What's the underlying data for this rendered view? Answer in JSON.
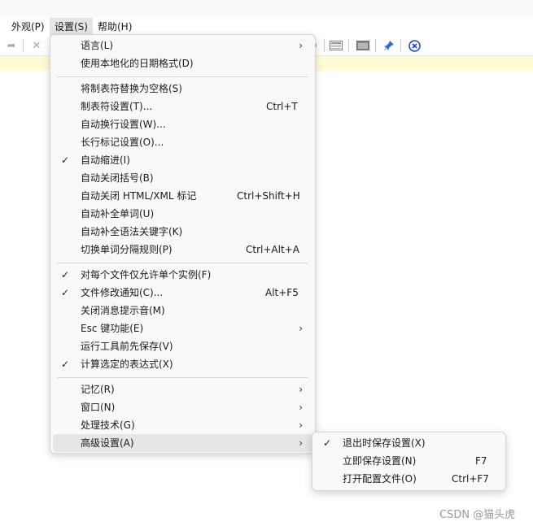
{
  "menubar": [
    "外观(P)",
    "设置(S)",
    "帮助(H)"
  ],
  "settings_menu": {
    "items": [
      {
        "label": "语言(L)",
        "check": false,
        "shortcut": "",
        "submenu": true
      },
      {
        "label": "使用本地化的日期格式(D)",
        "check": false,
        "shortcut": "",
        "submenu": false
      },
      {
        "label": "将制表符替换为空格(S)",
        "check": false,
        "shortcut": "",
        "submenu": false
      },
      {
        "label": "制表符设置(T)...",
        "check": false,
        "shortcut": "Ctrl+T",
        "submenu": false
      },
      {
        "label": "自动换行设置(W)...",
        "check": false,
        "shortcut": "",
        "submenu": false
      },
      {
        "label": "长行标记设置(O)...",
        "check": false,
        "shortcut": "",
        "submenu": false
      },
      {
        "label": "自动缩进(I)",
        "check": true,
        "shortcut": "",
        "submenu": false
      },
      {
        "label": "自动关闭括号(B)",
        "check": false,
        "shortcut": "",
        "submenu": false
      },
      {
        "label": "自动关闭 HTML/XML 标记",
        "check": false,
        "shortcut": "Ctrl+Shift+H",
        "submenu": false
      },
      {
        "label": "自动补全单词(U)",
        "check": false,
        "shortcut": "",
        "submenu": false
      },
      {
        "label": "自动补全语法关键字(K)",
        "check": false,
        "shortcut": "",
        "submenu": false
      },
      {
        "label": "切换单词分隔规则(P)",
        "check": false,
        "shortcut": "Ctrl+Alt+A",
        "submenu": false
      },
      {
        "label": "对每个文件仅允许单个实例(F)",
        "check": true,
        "shortcut": "",
        "submenu": false
      },
      {
        "label": "文件修改通知(C)...",
        "check": true,
        "shortcut": "Alt+F5",
        "submenu": false
      },
      {
        "label": "关闭消息提示音(M)",
        "check": false,
        "shortcut": "",
        "submenu": false
      },
      {
        "label": "Esc 键功能(E)",
        "check": false,
        "shortcut": "",
        "submenu": true
      },
      {
        "label": "运行工具前先保存(V)",
        "check": false,
        "shortcut": "",
        "submenu": false
      },
      {
        "label": "计算选定的表达式(X)",
        "check": true,
        "shortcut": "",
        "submenu": false
      },
      {
        "label": "记忆(R)",
        "check": false,
        "shortcut": "",
        "submenu": true
      },
      {
        "label": "窗口(N)",
        "check": false,
        "shortcut": "",
        "submenu": true
      },
      {
        "label": "处理技术(G)",
        "check": false,
        "shortcut": "",
        "submenu": true
      },
      {
        "label": "高级设置(A)",
        "check": false,
        "shortcut": "",
        "submenu": true,
        "highlighted": true
      }
    ]
  },
  "advanced_submenu": {
    "items": [
      {
        "label": "退出时保存设置(X)",
        "check": true,
        "shortcut": ""
      },
      {
        "label": "立即保存设置(N)",
        "check": false,
        "shortcut": "F7"
      },
      {
        "label": "打开配置文件(O)",
        "check": false,
        "shortcut": "Ctrl+F7"
      }
    ]
  },
  "toolbar_icons": [
    "redo-icon",
    "delete-icon",
    "view-icon",
    "keyboard-icon",
    "window-icon",
    "pin-icon",
    "close-circle-icon"
  ],
  "watermark": "CSDN @猫头虎",
  "colors": {
    "highlight": "#e6e6e6",
    "infobar": "#fffbd5",
    "pin": "#2b6cd6",
    "close": "#1f4fb8"
  }
}
